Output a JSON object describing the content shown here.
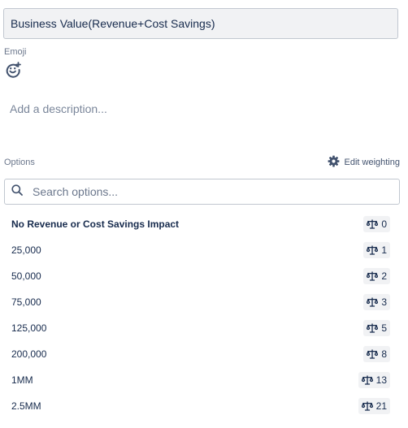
{
  "field": {
    "title_value": "Business Value(Revenue+Cost Savings)"
  },
  "emoji": {
    "label": "Emoji",
    "icon": "add-emoji-icon"
  },
  "description": {
    "placeholder": "Add a description..."
  },
  "options": {
    "label": "Options",
    "edit_weighting_label": "Edit weighting",
    "edit_weighting_icon": "gear-icon",
    "search_placeholder": "Search options...",
    "weight_icon": "scale-icon",
    "items": [
      {
        "label": "No Revenue or Cost Savings Impact",
        "weight": "0"
      },
      {
        "label": "25,000",
        "weight": "1"
      },
      {
        "label": "50,000",
        "weight": "2"
      },
      {
        "label": "75,000",
        "weight": "3"
      },
      {
        "label": "125,000",
        "weight": "5"
      },
      {
        "label": "200,000",
        "weight": "8"
      },
      {
        "label": "1MM",
        "weight": "13"
      },
      {
        "label": "2.5MM",
        "weight": "21"
      }
    ]
  },
  "colors": {
    "text": "#172b4d",
    "subtle_text": "#6b778c",
    "field_bg": "#f1f2f4",
    "border": "#c1c7d0"
  }
}
